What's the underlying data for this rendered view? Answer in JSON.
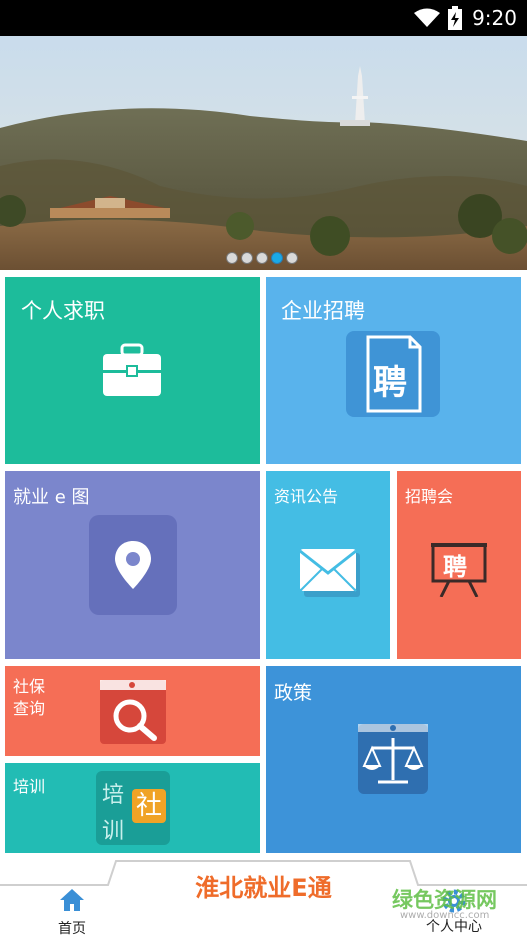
{
  "status_bar": {
    "time": "9:20"
  },
  "banner": {
    "slide_count": 5,
    "active_slide": 4
  },
  "tiles": {
    "job_seeking": {
      "label": "个人求职",
      "color": "#1dbc9b"
    },
    "enterprise_recruit": {
      "label": "企业招聘",
      "color": "#59b3ec",
      "icon_char": "聘"
    },
    "employment_map": {
      "label": "就业 e 图",
      "color": "#7b86cc"
    },
    "news_notice": {
      "label": "资讯公告",
      "color": "#44bde4"
    },
    "job_fair": {
      "label": "招聘会",
      "color": "#f56e56",
      "icon_char": "聘"
    },
    "social_security": {
      "label": "社保\n查询",
      "line1": "社保",
      "line2": "查询",
      "color": "#f56e56"
    },
    "policy": {
      "label": "政策",
      "color": "#3d93d9"
    },
    "training": {
      "label": "培训",
      "color": "#22bcb4",
      "icon_chars": [
        "培",
        "训",
        "社"
      ]
    }
  },
  "app_title": "淮北就业E通",
  "bottom_nav": {
    "home": "首页",
    "personal_center": "个人中心"
  },
  "watermark": {
    "text": "绿色资源网",
    "url_text": "www.downcc.com"
  }
}
